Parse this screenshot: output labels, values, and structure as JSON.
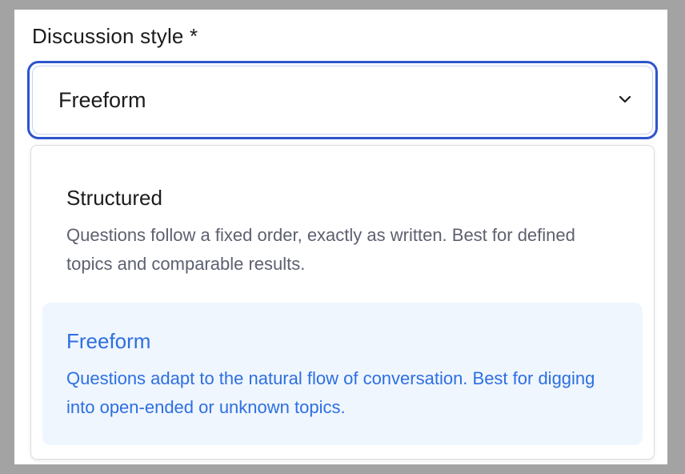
{
  "field": {
    "label": "Discussion style *",
    "selected_value": "Freeform",
    "chevron_icon": "chevron-down-icon"
  },
  "options": [
    {
      "title": "Structured",
      "description": "Questions follow a fixed order, exactly as written. Best for defined topics and comparable results.",
      "selected": false
    },
    {
      "title": "Freeform",
      "description": "Questions adapt to the natural flow of conversation. Best for digging into open-ended or unknown topics.",
      "selected": true
    }
  ],
  "colors": {
    "focus_border": "#2d55cc",
    "selected_text": "#2e6fe0",
    "selected_bg": "#eff6fe",
    "muted_text": "#5d6070"
  }
}
